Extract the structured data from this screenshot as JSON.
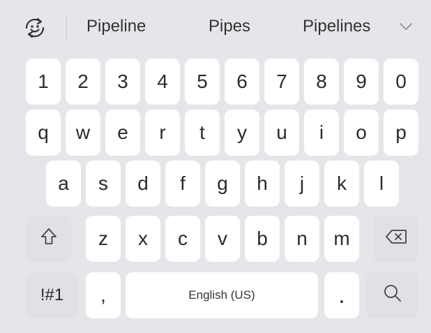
{
  "suggestion_bar": {
    "emoji_icon": "emoji-icon",
    "suggestions": [
      "Pipeline",
      "Pipes",
      "Pipelines"
    ],
    "collapse_icon": "chevron-down-icon"
  },
  "keyboard": {
    "number_row": [
      "1",
      "2",
      "3",
      "4",
      "5",
      "6",
      "7",
      "8",
      "9",
      "0"
    ],
    "row1": [
      "q",
      "w",
      "e",
      "r",
      "t",
      "y",
      "u",
      "i",
      "o",
      "p"
    ],
    "row2": [
      "a",
      "s",
      "d",
      "f",
      "g",
      "h",
      "j",
      "k",
      "l"
    ],
    "row3": [
      "z",
      "x",
      "c",
      "v",
      "b",
      "n",
      "m"
    ],
    "shift_icon": "shift-icon",
    "backspace_icon": "backspace-icon",
    "symbols_label": "!#1",
    "comma_label": ",",
    "space_label": "English (US)",
    "period_label": ".",
    "search_icon": "search-icon"
  }
}
